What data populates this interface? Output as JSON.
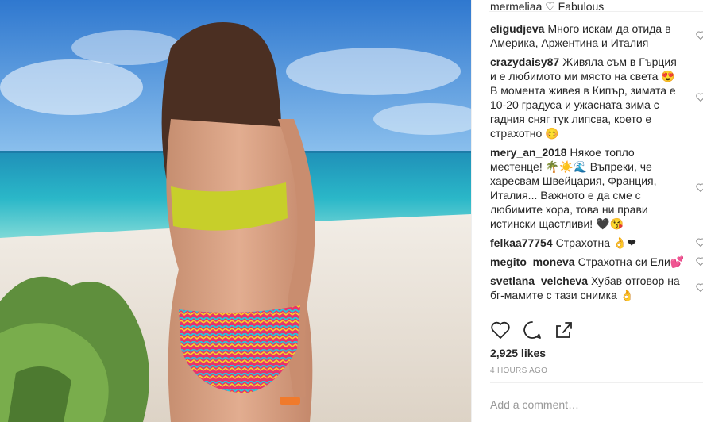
{
  "post": {
    "cut_comment": "mermeliaa ♡ Fabulous",
    "comments": [
      {
        "user": "eligudjeva",
        "text": "Много искам да отида в Америка, Аржентина и Италия"
      },
      {
        "user": "crazydaisy87",
        "text": "Живяла съм в Гърция и е любимото ми място на света 😍 В момента живея в Кипър, зимата е 10-20 градуса и ужасната зима с гадния сняг тук липсва, което е страхотно 😊"
      },
      {
        "user": "mery_an_2018",
        "text": "Някое топло местенце! 🌴☀️🌊 Въпреки, че харесвам Швейцария, Франция, Италия... Важното е да сме с любимите хора, това ни прави истински щастливи! 🖤😘"
      },
      {
        "user": "felkaa77754",
        "text": "Страхотна 👌❤"
      },
      {
        "user": "megito_moneva",
        "text": "Страхотна си Ели💕"
      },
      {
        "user": "svetlana_velcheva",
        "text": "Хубав отговор на бг-мамите с тази снимка 👌"
      }
    ],
    "likes": "2,925 likes",
    "time": "4 HOURS AGO",
    "add_comment_placeholder": "Add a comment…"
  },
  "colors": {
    "sky": "#3e86d6",
    "sea": "#2bb3c7",
    "sand": "#e9e2d8",
    "accent": "#f0513b"
  },
  "icons": [
    "heart-icon",
    "comment-icon",
    "share-icon",
    "like-comment-heart-icon"
  ]
}
